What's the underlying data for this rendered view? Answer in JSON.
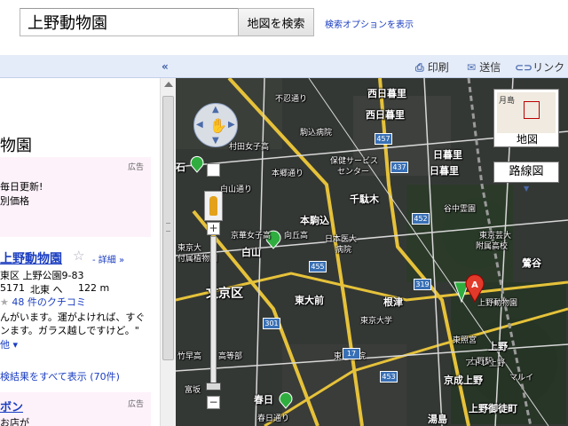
{
  "search": {
    "query": "上野動物園",
    "button_label": "地図を検索",
    "options_link": "検索オプションを表示"
  },
  "panel": {
    "collapse_glyph": "«",
    "place_title": "物園",
    "ad1": {
      "label": "広告",
      "line1": "毎日更新!",
      "line2": "別価格"
    },
    "result": {
      "title": "上野動物園",
      "detail_link": "- 詳細 »",
      "address": "東区 上野公園9-83",
      "phone": "5171",
      "direction": "北東 へ",
      "distance": "122 m",
      "reviews": "48 件のクチコミ",
      "snippet1": "んがいます。運がよければ、すぐ",
      "snippet2": "ンます。ガラス越しですけど。\"",
      "more": "他 ▾"
    },
    "all_results": "検結果をすべて表示 (70件)",
    "ad2": {
      "label": "広告",
      "title": "ボン",
      "text": "お店が"
    }
  },
  "toolbar": {
    "print": "印刷",
    "send": "送信",
    "link": "リンク"
  },
  "map_controls": {
    "zoom_in": "+",
    "zoom_out": "−",
    "overview_label": "地図",
    "route_label": "路線図",
    "overview_place": "月島"
  },
  "map_labels": [
    {
      "text": "不忍通り",
      "size": "sm"
    },
    {
      "text": "西日暮里",
      "size": "md"
    },
    {
      "text": "西日暮里",
      "size": "md"
    },
    {
      "text": "駒込病院",
      "size": "sm"
    },
    {
      "text": "日暮里",
      "size": "md"
    },
    {
      "text": "日暮里",
      "size": "md"
    },
    {
      "text": "保健サービス",
      "size": "sm"
    },
    {
      "text": "センター",
      "size": "sm"
    },
    {
      "text": "千駄木",
      "size": "md"
    },
    {
      "text": "谷中霊園",
      "size": "sm"
    },
    {
      "text": "本駒込",
      "size": "md"
    },
    {
      "text": "白山",
      "size": "md"
    },
    {
      "text": "日本医大",
      "size": "sm"
    },
    {
      "text": "病院",
      "size": "sm"
    },
    {
      "text": "文京区",
      "size": "lg"
    },
    {
      "text": "東大前",
      "size": "md"
    },
    {
      "text": "根津",
      "size": "md"
    },
    {
      "text": "上野動物園",
      "size": "sm"
    },
    {
      "text": "東京大学",
      "size": "sm"
    },
    {
      "text": "上野",
      "size": "md"
    },
    {
      "text": "京成上野",
      "size": "md"
    },
    {
      "text": "上野御徒町",
      "size": "md"
    },
    {
      "text": "湯島",
      "size": "md"
    },
    {
      "text": "春日",
      "size": "md"
    },
    {
      "text": "鶯谷",
      "size": "md"
    },
    {
      "text": "東京芸大",
      "size": "sm"
    },
    {
      "text": "附属高校",
      "size": "sm"
    },
    {
      "text": "京華女子高",
      "size": "sm"
    },
    {
      "text": "向丘高",
      "size": "sm"
    },
    {
      "text": "東京大",
      "size": "sm"
    },
    {
      "text": "付属植物園",
      "size": "sm"
    },
    {
      "text": "東博物館",
      "size": "sm"
    },
    {
      "text": "上野駅",
      "size": "sm"
    },
    {
      "text": "東照宮",
      "size": "sm"
    },
    {
      "text": "アトレ上野",
      "size": "sm"
    },
    {
      "text": "マルイ",
      "size": "sm"
    },
    {
      "text": "竹早高",
      "size": "sm"
    },
    {
      "text": "高等部",
      "size": "sm"
    },
    {
      "text": "富坂",
      "size": "sm"
    },
    {
      "text": "春日通り",
      "size": "sm"
    },
    {
      "text": "東大病院",
      "size": "sm"
    },
    {
      "text": "上野広小路",
      "size": "sm"
    },
    {
      "text": "村田女子高",
      "size": "sm"
    },
    {
      "text": "白山通り",
      "size": "sm"
    },
    {
      "text": "本郷通り",
      "size": "sm"
    },
    {
      "text": "石",
      "size": "md"
    },
    {
      "text": "上野",
      "size": "sm"
    }
  ],
  "route_shields": [
    "457",
    "437",
    "452",
    "455",
    "319",
    "301",
    "17",
    "453"
  ]
}
